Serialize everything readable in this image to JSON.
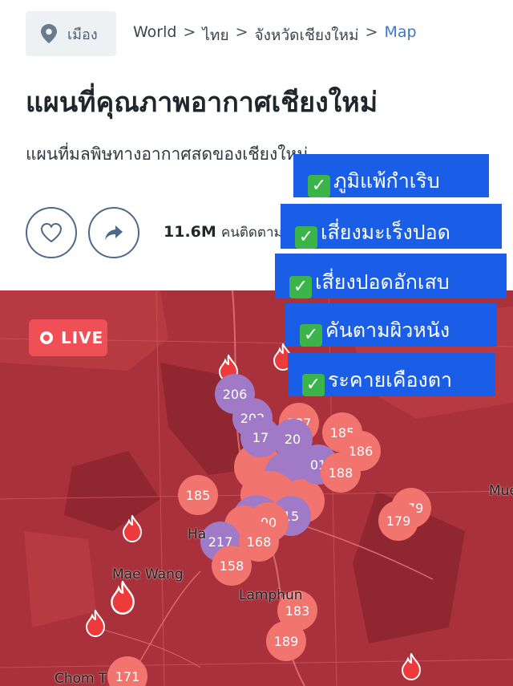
{
  "header": {
    "city_chip_label": "เมือง",
    "breadcrumb": [
      "World",
      "ไทย",
      "จังหวัดเชียงใหม่",
      "Map"
    ],
    "breadcrumb_sep": ">"
  },
  "page": {
    "title": "แผนที่คุณภาพอากาศเชียงใหม่",
    "subtitle": "แผนที่มลพิษทางอากาศสดของเชียงใหม่"
  },
  "actions": {
    "like_icon": "heart-icon",
    "share_icon": "share-icon",
    "followers_count": "11.6M",
    "followers_label": "คนติดตาม"
  },
  "overlay_tags": [
    {
      "check": "✓",
      "text": "ภูมิแพ้กำเริบ"
    },
    {
      "check": "✓",
      "text": "เสี่ยงมะเร็งปอด"
    },
    {
      "check": "✓",
      "text": "เสี่ยงปอดอักเสบ"
    },
    {
      "check": "✓",
      "text": "คันตามผิวหนัง"
    },
    {
      "check": "✓",
      "text": "ระคายเคืองตา"
    }
  ],
  "map": {
    "live_label": "LIVE",
    "place_labels": [
      "Mae Wang",
      "Lamphun",
      "Chom T",
      "Ha",
      "Mue"
    ],
    "aqi_markers": [
      "206",
      "202",
      "187",
      "185",
      "186",
      "188",
      "185",
      "179",
      "179",
      "217",
      "168",
      "158",
      "183",
      "189",
      "171",
      "15",
      "20",
      "17",
      "00",
      "01",
      "00"
    ],
    "colors": {
      "map_bg": "#a8313b",
      "marker_red": "#f1746e",
      "marker_purple": "#a07ac7",
      "tag_blue": "#1a5ee8",
      "live_red": "#ef5056"
    }
  }
}
